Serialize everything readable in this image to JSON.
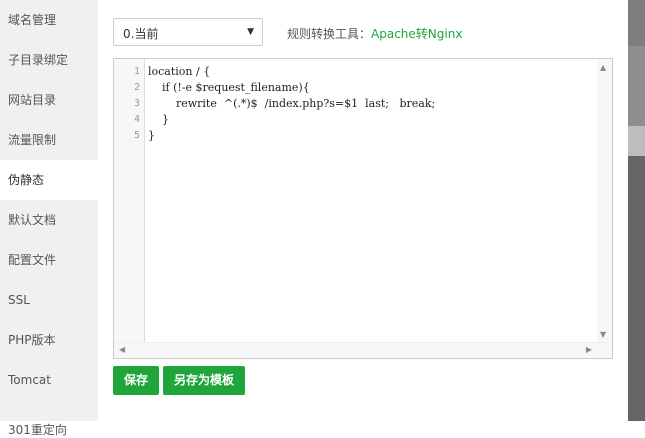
{
  "sidebar": {
    "items": [
      {
        "label": "域名管理"
      },
      {
        "label": "子目录绑定"
      },
      {
        "label": "网站目录"
      },
      {
        "label": "流量限制"
      },
      {
        "label": "伪静态"
      },
      {
        "label": "默认文档"
      },
      {
        "label": "配置文件"
      },
      {
        "label": "SSL"
      },
      {
        "label": "PHP版本"
      },
      {
        "label": "Tomcat"
      },
      {
        "label": "301重定向"
      }
    ],
    "active_index": 4
  },
  "rewrite_select": {
    "selected": "0.当前"
  },
  "converter": {
    "label": "规则转换工具：",
    "link": "Apache转Nginx"
  },
  "editor": {
    "line_numbers": [
      "1",
      "2",
      "3",
      "4",
      "5"
    ],
    "lines": [
      "location / {",
      "    if (!-e $request_filename){",
      "        rewrite  ^(.*)$  /index.php?s=$1  last;   break;",
      "    }",
      "}"
    ]
  },
  "buttons": {
    "save": "保存",
    "save_as_template": "另存为模板"
  },
  "colors": {
    "accent": "#20a53a",
    "sidebar_bg": "#f0f0f0"
  }
}
